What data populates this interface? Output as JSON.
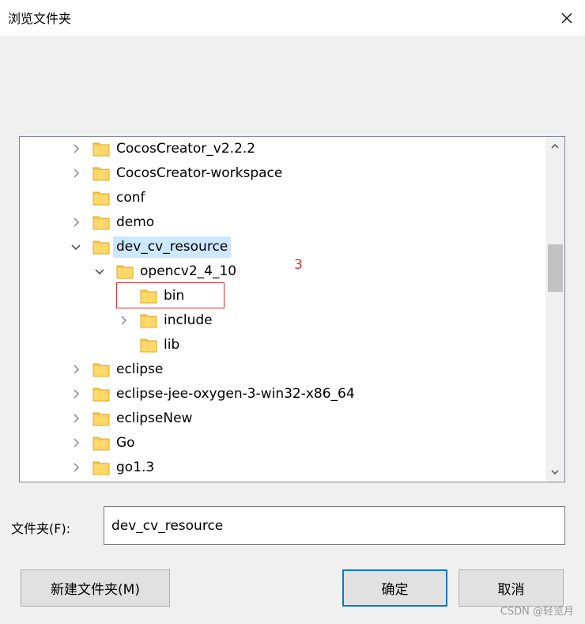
{
  "window": {
    "title": "浏览文件夹",
    "close_icon": "close-icon"
  },
  "tree": {
    "items": [
      {
        "label": "CocosCreator_v2.2.2",
        "level": 0,
        "expander": "collapsed"
      },
      {
        "label": "CocosCreator-workspace",
        "level": 0,
        "expander": "collapsed"
      },
      {
        "label": "conf",
        "level": 0,
        "expander": "none"
      },
      {
        "label": "demo",
        "level": 0,
        "expander": "collapsed"
      },
      {
        "label": "dev_cv_resource",
        "level": 0,
        "expander": "expanded",
        "selected": true
      },
      {
        "label": "opencv2_4_10",
        "level": 1,
        "expander": "expanded"
      },
      {
        "label": "bin",
        "level": 2,
        "expander": "none",
        "boxed": true
      },
      {
        "label": "include",
        "level": 2,
        "expander": "collapsed"
      },
      {
        "label": "lib",
        "level": 2,
        "expander": "none"
      },
      {
        "label": "eclipse",
        "level": 0,
        "expander": "collapsed"
      },
      {
        "label": "eclipse-jee-oxygen-3-win32-x86_64",
        "level": 0,
        "expander": "collapsed"
      },
      {
        "label": "eclipseNew",
        "level": 0,
        "expander": "collapsed"
      },
      {
        "label": "Go",
        "level": 0,
        "expander": "collapsed"
      },
      {
        "label": "go1.3",
        "level": 0,
        "expander": "collapsed"
      }
    ],
    "annotation": "3",
    "folder_icon_color": "#f8c64b",
    "selection_color": "#cce8ff",
    "box_color": "#e03030"
  },
  "scrollbar": {
    "up_icon": "chevron-up-icon",
    "down_icon": "chevron-down-icon"
  },
  "folder_field": {
    "label": "文件夹(F):",
    "value": "dev_cv_resource"
  },
  "buttons": {
    "new_folder": "新建文件夹(M)",
    "ok": "确定",
    "cancel": "取消"
  },
  "watermark": "CSDN @轻览月",
  "colors": {
    "accent": "#0078d7",
    "dialog_bg": "#f0f0f0"
  }
}
